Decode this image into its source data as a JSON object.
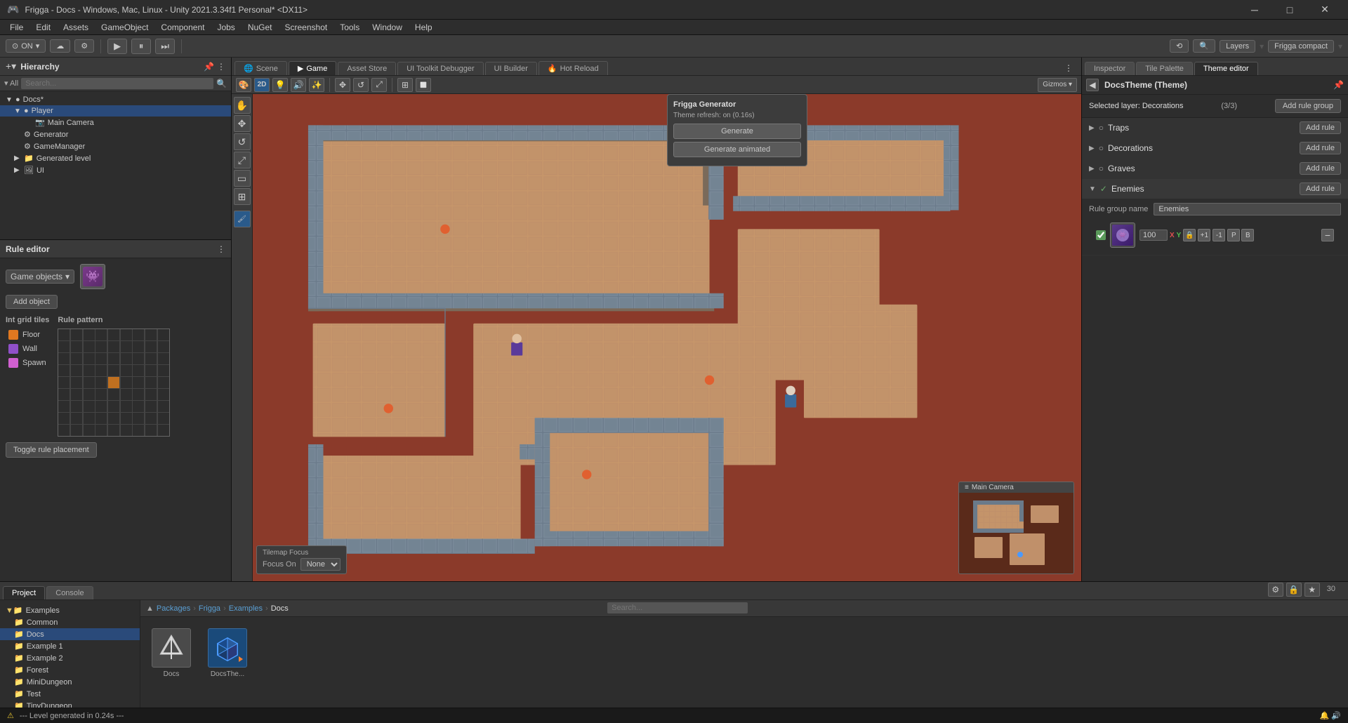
{
  "window": {
    "title": "Frigga - Docs - Windows, Mac, Linux - Unity 2021.3.34f1 Personal* <DX11>"
  },
  "menu": {
    "items": [
      "File",
      "Edit",
      "Assets",
      "GameObject",
      "Component",
      "Jobs",
      "NuGet",
      "Screenshot",
      "Tools",
      "Window",
      "Help"
    ]
  },
  "toolbar": {
    "on_label": "ON",
    "layers_label": "Layers",
    "frigga_compact_label": "Frigga compact"
  },
  "tabs": {
    "scene": "Scene",
    "game": "Game",
    "asset_store": "Asset Store",
    "ui_toolkit": "UI Toolkit Debugger",
    "ui_builder": "UI Builder",
    "hot_reload": "Hot Reload"
  },
  "right_tabs": {
    "inspector": "Inspector",
    "tile_palette": "Tile Palette",
    "theme_editor": "Theme editor"
  },
  "hierarchy": {
    "title": "Hierarchy",
    "search_placeholder": "All",
    "items": [
      {
        "label": "Docs*",
        "level": 0,
        "expanded": true,
        "icon": "📄"
      },
      {
        "label": "Player",
        "level": 1,
        "expanded": true,
        "icon": "🎮",
        "selected": true
      },
      {
        "label": "Main Camera",
        "level": 2,
        "expanded": false,
        "icon": "📷"
      },
      {
        "label": "Generator",
        "level": 1,
        "expanded": false,
        "icon": "⚙️"
      },
      {
        "label": "GameManager",
        "level": 1,
        "expanded": false,
        "icon": "⚙️"
      },
      {
        "label": "Generated level",
        "level": 1,
        "expanded": true,
        "icon": "📁"
      },
      {
        "label": "UI",
        "level": 1,
        "expanded": false,
        "icon": "🖼️"
      }
    ]
  },
  "rule_editor": {
    "title": "Rule editor",
    "game_objects_label": "Game objects",
    "add_object_btn": "Add object",
    "int_grid_tiles_label": "Int grid tiles",
    "rule_pattern_label": "Rule pattern",
    "toggle_rule_btn": "Toggle rule placement",
    "tiles": [
      {
        "name": "Floor",
        "color": "#e07820"
      },
      {
        "name": "Wall",
        "color": "#9050c8"
      },
      {
        "name": "Spawn",
        "color": "#d060d0"
      }
    ]
  },
  "frigga_generator": {
    "title": "Frigga Generator",
    "subtitle": "Theme refresh: on (0.16s)",
    "generate_btn": "Generate",
    "generate_animated_btn": "Generate animated"
  },
  "main_camera": {
    "title": "Main Camera"
  },
  "tilemap_focus": {
    "title": "Tilemap Focus",
    "focus_on_label": "Focus On",
    "none_option": "None"
  },
  "inspector": {
    "title": "DocsTheme (Theme)",
    "selected_layer": "Selected layer: Decorations",
    "layer_count": "(3/3)",
    "add_rule_group_btn": "Add rule group",
    "rule_groups": [
      {
        "name": "Traps",
        "add_rule": "Add rule",
        "expanded": false,
        "checked": false
      },
      {
        "name": "Decorations",
        "add_rule": "Add rule",
        "expanded": false,
        "checked": false
      },
      {
        "name": "Graves",
        "add_rule": "Add rule",
        "expanded": false,
        "checked": false
      },
      {
        "name": "Enemies",
        "add_rule": "Add rule",
        "expanded": true,
        "checked": true
      }
    ],
    "rule_group_name_label": "Rule group name",
    "enemies_name": "Enemies",
    "enemies_value_100": "100"
  },
  "project": {
    "title": "Project",
    "console": "Console",
    "search_placeholder": "Search",
    "breadcrumb": [
      "Packages",
      "Frigga",
      "Examples",
      "Docs"
    ],
    "file_tree": [
      {
        "label": "Examples",
        "level": 0,
        "icon": "📁",
        "expanded": true
      },
      {
        "label": "Common",
        "level": 1,
        "icon": "📁"
      },
      {
        "label": "Docs",
        "level": 1,
        "icon": "📁",
        "selected": true
      },
      {
        "label": "Example 1",
        "level": 1,
        "icon": "📁"
      },
      {
        "label": "Example 2",
        "level": 1,
        "icon": "📁"
      },
      {
        "label": "Forest",
        "level": 1,
        "icon": "📁"
      },
      {
        "label": "MiniDungeon",
        "level": 1,
        "icon": "📁"
      },
      {
        "label": "Test",
        "level": 1,
        "icon": "📁"
      },
      {
        "label": "TinyDungeon",
        "level": 1,
        "icon": "📁"
      }
    ],
    "assets": [
      {
        "label": "Docs",
        "icon_color": "#5a5a5a",
        "icon_type": "unity"
      },
      {
        "label": "DocsThe...",
        "icon_color": "#3a7ab8",
        "icon_type": "frigga"
      }
    ]
  },
  "status_bar": {
    "message": "--- Level generated in 0.24s ---"
  },
  "icons": {
    "search": "🔍",
    "settings": "⚙",
    "dots": "⋮",
    "plus": "+",
    "minus": "−",
    "expand": "▶",
    "collapse": "▼",
    "hand": "✋",
    "move": "✥",
    "rotate": "↺",
    "scale": "⤢",
    "rect": "▭",
    "transform": "⊞",
    "lock": "🔒",
    "eye": "👁",
    "play": "▶",
    "pause": "⏸",
    "step": "⏭"
  }
}
